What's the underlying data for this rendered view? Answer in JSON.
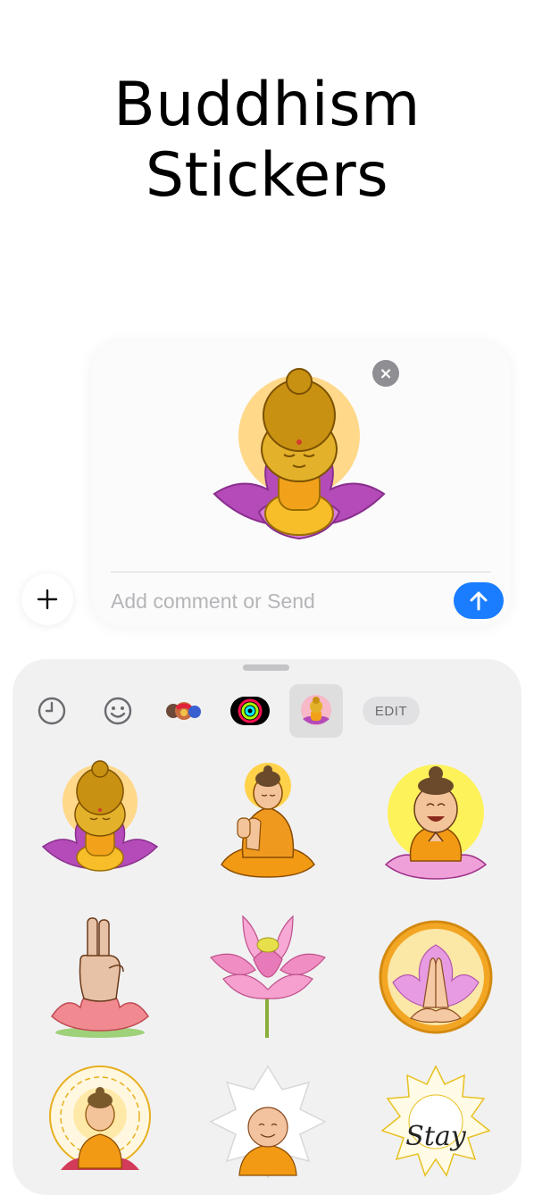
{
  "app": {
    "title": "Buddhism Stickers"
  },
  "compose": {
    "comment_placeholder": "Add comment or Send",
    "selected_sticker": "baby-buddha-lotus-sticker",
    "remove_icon": "close-icon",
    "send_icon": "arrow-up-icon"
  },
  "plus_button": {
    "icon": "plus-icon"
  },
  "drawer": {
    "tabs": [
      {
        "name": "recents-clock-icon",
        "selected": false
      },
      {
        "name": "emoji-smiley-icon",
        "selected": false
      },
      {
        "name": "memoji-stickers-icon",
        "selected": false
      },
      {
        "name": "activity-rings-icon",
        "selected": false
      },
      {
        "name": "buddhism-stickers-icon",
        "selected": true
      }
    ],
    "edit_label": "EDIT",
    "stickers": [
      "baby-buddha-lotus",
      "meditating-buddha-orange-robe",
      "laughing-buddha-yellow-halo",
      "blessing-hand-on-lotus",
      "pink-lotus-flower",
      "praying-hands-lotus-circle",
      "mandala-buddha",
      "smiling-monk-mandala",
      "stay-mandala"
    ],
    "sticker_texts": {
      "stay_text": "Stay"
    }
  },
  "colors": {
    "accent_blue": "#1a7dff",
    "lotus_purple": "#b44bb8",
    "halo_yellow": "#ffd88a",
    "robe_orange": "#f2a21a"
  }
}
